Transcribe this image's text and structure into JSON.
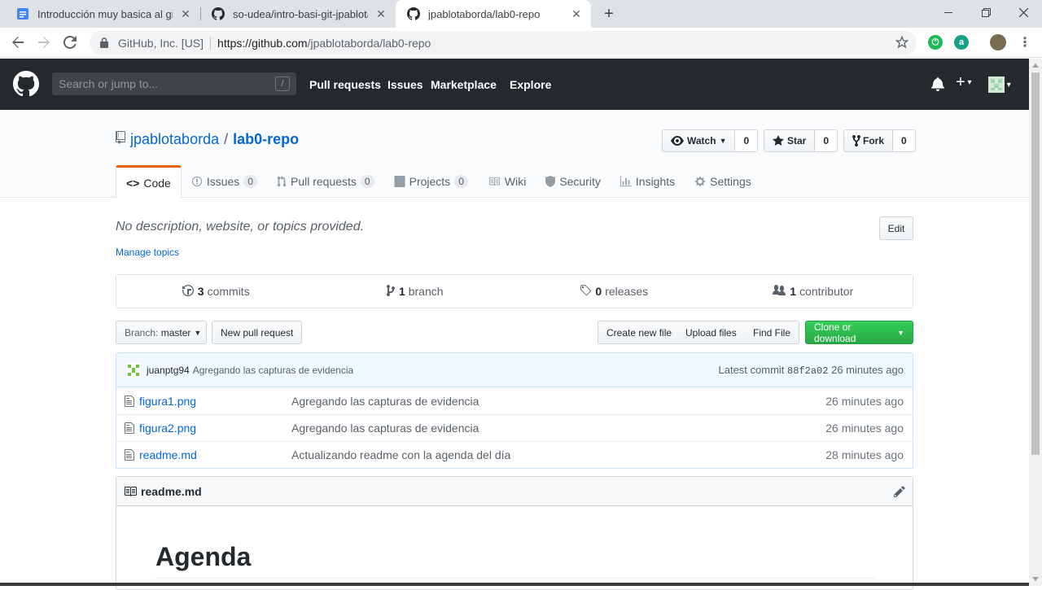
{
  "browser": {
    "tabs": [
      {
        "title": "Introducción muy basica al git",
        "icon": "google-docs-icon",
        "active": false
      },
      {
        "title": "so-udea/intro-basi-git-jpablotab",
        "icon": "github-icon",
        "active": false
      },
      {
        "title": "jpablotaborda/lab0-repo",
        "icon": "github-icon",
        "active": true
      }
    ],
    "org_label": "GitHub, Inc. [US]",
    "url_scheme_host": "https://github.com",
    "url_path": "/jpablotaborda/lab0-repo"
  },
  "gh": {
    "search_placeholder": "Search or jump to...",
    "search_shortcut": "/",
    "nav": [
      "Pull requests",
      "Issues",
      "Marketplace",
      "Explore"
    ]
  },
  "repo": {
    "owner": "jpablotaborda",
    "separator": "/",
    "name": "lab0-repo",
    "watch": {
      "label": "Watch",
      "count": "0"
    },
    "star": {
      "label": "Star",
      "count": "0"
    },
    "fork": {
      "label": "Fork",
      "count": "0"
    },
    "tabs": {
      "code": "Code",
      "issues": "Issues",
      "issues_count": "0",
      "pulls": "Pull requests",
      "pulls_count": "0",
      "projects": "Projects",
      "projects_count": "0",
      "wiki": "Wiki",
      "security": "Security",
      "insights": "Insights",
      "settings": "Settings"
    },
    "description": "No description, website, or topics provided.",
    "edit_label": "Edit",
    "manage_topics": "Manage topics",
    "summary": {
      "commits_num": "3",
      "commits_label": "commits",
      "branches_num": "1",
      "branches_label": "branch",
      "releases_num": "0",
      "releases_label": "releases",
      "contributors_num": "1",
      "contributors_label": "contributor"
    },
    "branch_label": "Branch:",
    "branch_value": "master",
    "new_pr": "New pull request",
    "create_file": "Create new file",
    "upload_files": "Upload files",
    "find_file": "Find File",
    "clone": "Clone or download",
    "latest_commit": {
      "author": "juanptg94",
      "message": "Agregando las capturas de evidencia",
      "prefix": "Latest commit",
      "sha": "88f2a02",
      "age": "26 minutes ago"
    },
    "files": [
      {
        "name": "figura1.png",
        "message": "Agregando las capturas de evidencia",
        "age": "26 minutes ago"
      },
      {
        "name": "figura2.png",
        "message": "Agregando las capturas de evidencia",
        "age": "26 minutes ago"
      },
      {
        "name": "readme.md",
        "message": "Actualizando readme con la agenda del día",
        "age": "28 minutes ago"
      }
    ],
    "readme": {
      "filename": "readme.md",
      "heading": "Agenda"
    }
  }
}
